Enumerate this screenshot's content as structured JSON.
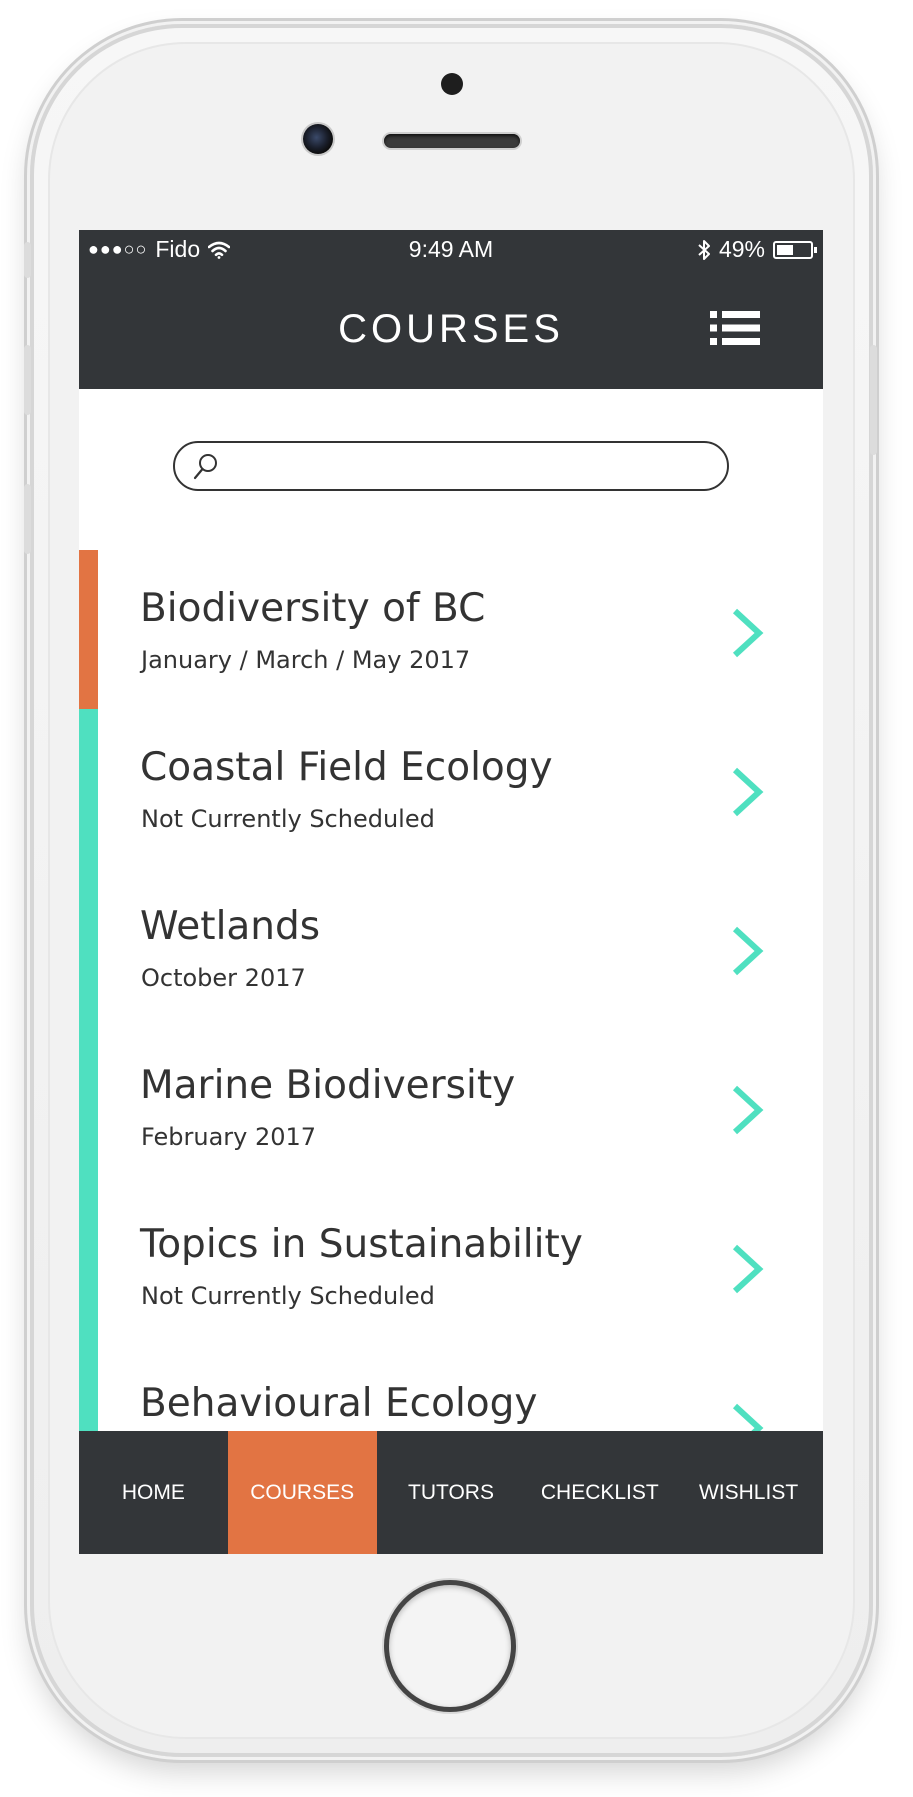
{
  "colors": {
    "header_bg": "#333639",
    "accent_active": "#E27443",
    "accent_inactive": "#4FE0C0",
    "chevron": "#4FE0C0",
    "text": "#333333"
  },
  "status_bar": {
    "signal": "●●●○○",
    "carrier": "Fido",
    "wifi_icon": "wifi-icon",
    "time": "9:49 AM",
    "bluetooth_icon": "bluetooth-icon",
    "battery_percent": "49%",
    "battery_level": 0.49
  },
  "header": {
    "title": "COURSES",
    "menu_icon": "list-menu-icon"
  },
  "search": {
    "placeholder": "",
    "value": "",
    "icon": "search-icon"
  },
  "courses": [
    {
      "title": "Biodiversity of BC",
      "date": "January / March / May 2017",
      "state": "active"
    },
    {
      "title": "Coastal Field Ecology",
      "date": "Not Currently Scheduled",
      "state": "inactive"
    },
    {
      "title": "Wetlands",
      "date": "October 2017",
      "state": "inactive"
    },
    {
      "title": "Marine Biodiversity",
      "date": "February 2017",
      "state": "inactive"
    },
    {
      "title": "Topics in Sustainability",
      "date": "Not Currently Scheduled",
      "state": "inactive"
    },
    {
      "title": "Behavioural Ecology",
      "date": "",
      "state": "inactive"
    }
  ],
  "tabs": [
    {
      "label": "HOME",
      "active": false
    },
    {
      "label": "COURSES",
      "active": true
    },
    {
      "label": "TUTORS",
      "active": false
    },
    {
      "label": "CHECKLIST",
      "active": false
    },
    {
      "label": "WISHLIST",
      "active": false
    }
  ]
}
